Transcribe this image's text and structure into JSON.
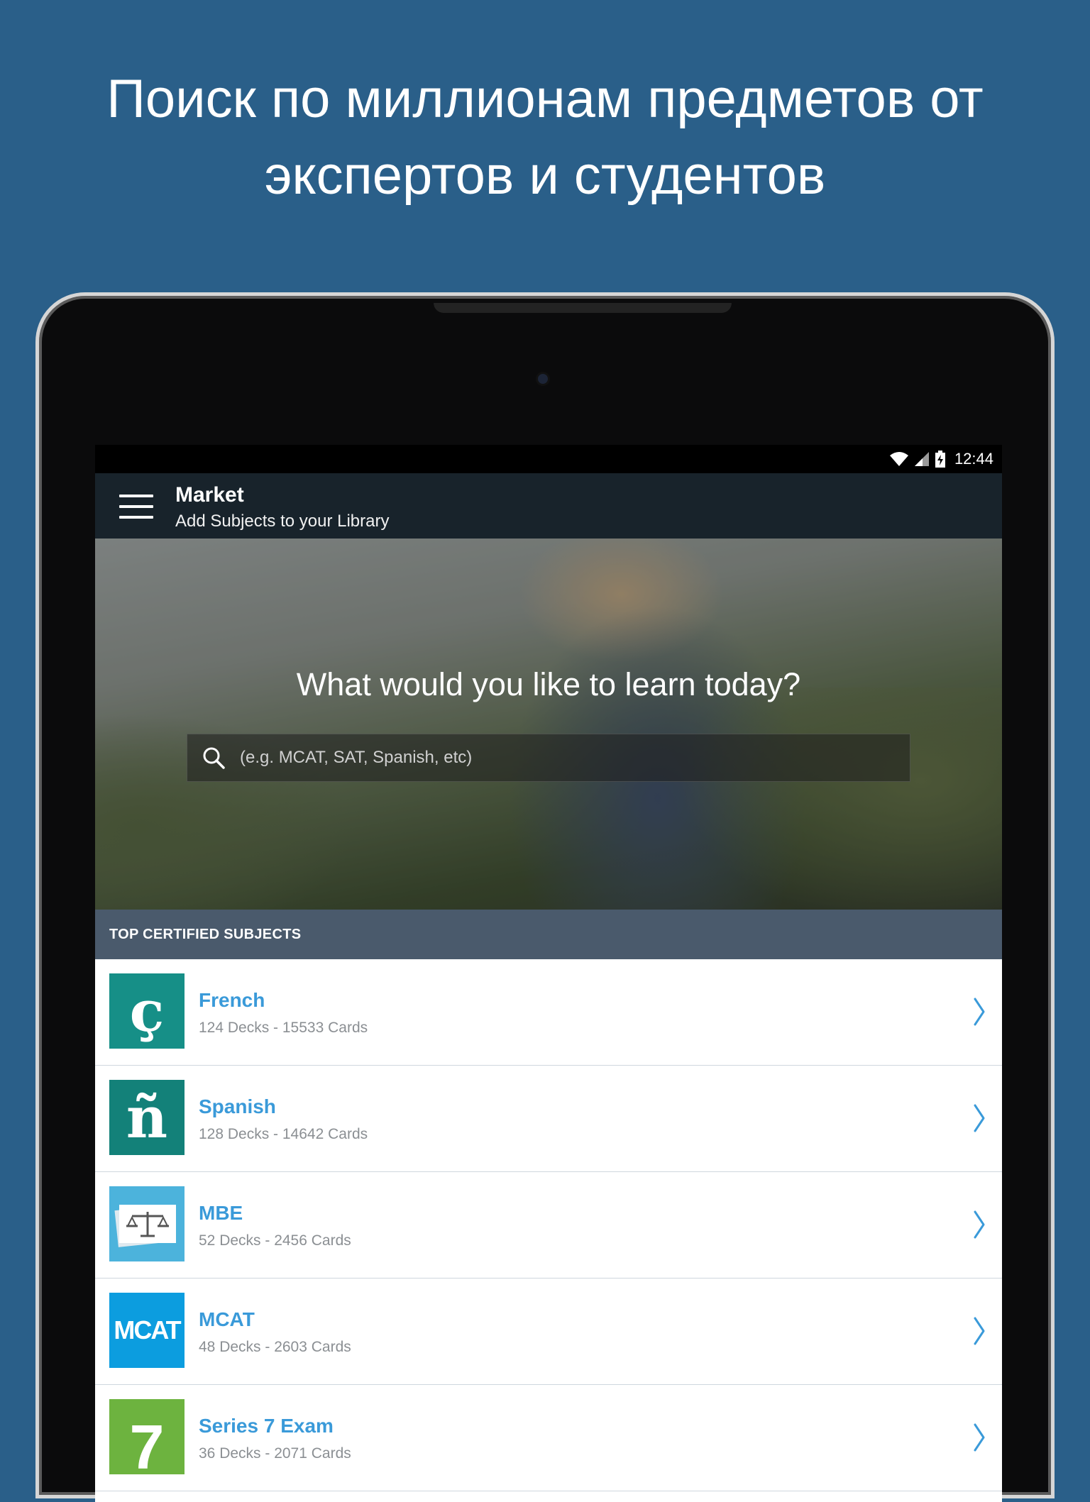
{
  "promo": {
    "line1": "Поиск по миллионам предметов от",
    "line2": "экспертов и студентов"
  },
  "status_bar": {
    "time": "12:44"
  },
  "appbar": {
    "title": "Market",
    "subtitle": "Add Subjects to your Library"
  },
  "hero": {
    "question": "What would you like to learn today?",
    "search_placeholder": "(e.g. MCAT, SAT, Spanish, etc)"
  },
  "section": {
    "title": "TOP CERTIFIED SUBJECTS"
  },
  "subjects": [
    {
      "name": "French",
      "meta": "124 Decks - 15533 Cards",
      "icon": "french-c-cedilla-icon",
      "glyph": "ç",
      "color": "#168f87"
    },
    {
      "name": "Spanish",
      "meta": "128 Decks - 14642 Cards",
      "icon": "spanish-n-tilde-icon",
      "glyph": "ñ",
      "color": "#138179"
    },
    {
      "name": "MBE",
      "meta": "52 Decks - 2456 Cards",
      "icon": "scales-of-justice-icon",
      "glyph": "",
      "color": "#4cb3dc"
    },
    {
      "name": "MCAT",
      "meta": "48 Decks - 2603 Cards",
      "icon": "mcat-logo-icon",
      "glyph": "MCAT",
      "color": "#0c9ddf"
    },
    {
      "name": "Series 7 Exam",
      "meta": "36 Decks - 2071 Cards",
      "icon": "series-7-logo-icon",
      "glyph": "7",
      "color": "#6db33f"
    }
  ],
  "colors": {
    "background": "#2a5f89",
    "appbar": "#18232b",
    "section_header": "#4a5a6c",
    "accent": "#3a9ad9"
  }
}
